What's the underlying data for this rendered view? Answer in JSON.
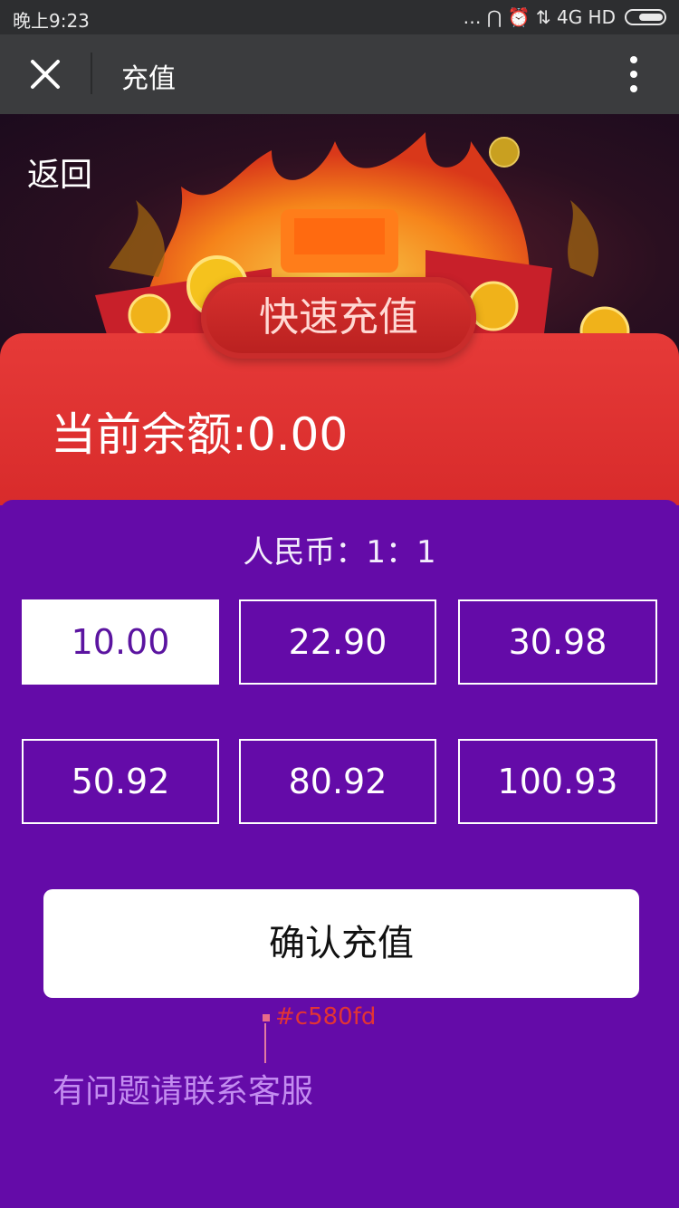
{
  "status_bar": {
    "time": "晚上9:23",
    "indicators": "… ⋂ ⏰  ⇅ 4G HD",
    "battery_icon": "battery-icon"
  },
  "nav": {
    "title": "充值",
    "close_icon": "close-icon",
    "more_icon": "more-vertical-icon"
  },
  "hero": {
    "back_label": "返回",
    "quick_label": "快速充值"
  },
  "balance": {
    "text": "当前余额:0.00"
  },
  "rate": {
    "text": "人民币：1：1"
  },
  "amounts": [
    {
      "label": "10.00",
      "selected": true
    },
    {
      "label": "22.90",
      "selected": false
    },
    {
      "label": "30.98",
      "selected": false
    },
    {
      "label": "50.92",
      "selected": false
    },
    {
      "label": "80.92",
      "selected": false
    },
    {
      "label": "100.93",
      "selected": false
    }
  ],
  "confirm_label": "确认充值",
  "annotation": "#c580fd",
  "help_text": "有问题请联系客服",
  "colors": {
    "background": "#640ba8",
    "red_band": "#e63a38",
    "help_text": "#c580fd"
  }
}
